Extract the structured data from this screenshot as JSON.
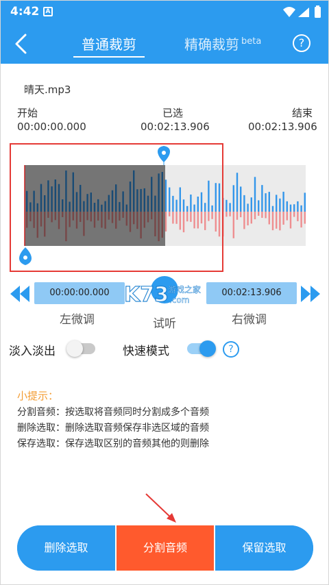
{
  "status": {
    "time": "4:42",
    "app_badge": "A"
  },
  "header": {
    "tab_normal": "普通裁剪",
    "tab_precise": "精确裁剪",
    "tab_precise_sup": "beta",
    "help": "?"
  },
  "file": {
    "name": "晴天.mp3"
  },
  "range": {
    "start_label": "开始",
    "start_value": "00:00:00.000",
    "selected_label": "已选",
    "selected_value": "00:02:13.906",
    "end_label": "结束",
    "end_value": "00:02:13.906"
  },
  "waveform": {
    "selection_fraction": 0.5
  },
  "controls": {
    "left_time": "00:00:00.000",
    "right_time": "00:02:13.906",
    "left_adjust": "左微调",
    "preview": "试听",
    "right_adjust": "右微调"
  },
  "options": {
    "fade_label": "淡入淡出",
    "fade_on": false,
    "fast_label": "快速模式",
    "fast_on": true,
    "help": "?"
  },
  "tips": {
    "title": "小提示：",
    "items": [
      "分割音频：按选取将音频同时分割成多个音频",
      "删除选取：删除选取音频保存非选区域的音频",
      "保存选取：保存选取区别的音频其他的则删除"
    ]
  },
  "actions": {
    "delete": "删除选取",
    "split": "分割音频",
    "keep": "保留选取"
  },
  "watermark": {
    "brand": "K73",
    "cn": "游戏之家",
    "domain": ".com"
  },
  "colors": {
    "primary": "#2c9bef",
    "accent": "#ff5a2d",
    "tip": "#f39c33",
    "wave_top": "#3396ea",
    "wave_bottom": "#ee8e90"
  }
}
